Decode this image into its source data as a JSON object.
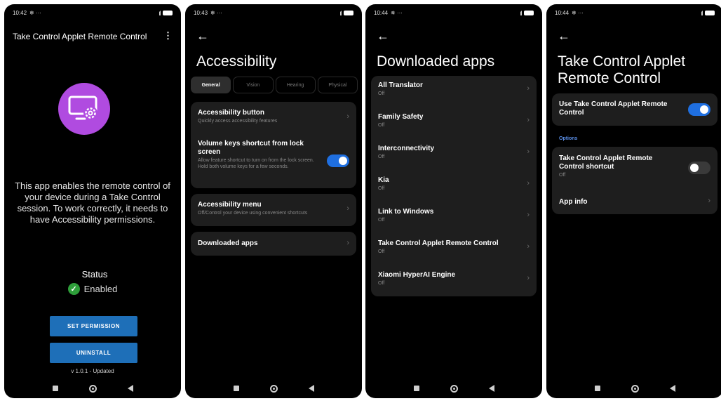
{
  "screen1": {
    "status_time": "10:42",
    "status_icons": "❄ ···",
    "battery": "96",
    "title": "Take Control Applet Remote Control",
    "menu_icon": "kebab-menu-icon",
    "description": "This app enables the remote control of your device during a Take Control session. To work correctly, it needs to have Accessibility permissions.",
    "status_label": "Status",
    "status_value": "Enabled",
    "set_permission": "SET PERMISSION",
    "uninstall": "UNINSTALL",
    "version": "v 1.0.1 - Updated",
    "accent": "#b04be0",
    "button_color": "#1e6fb8"
  },
  "screen2": {
    "status_time": "10:43",
    "status_icons": "❄ ···",
    "battery": "96",
    "title": "Accessibility",
    "tabs": [
      "General",
      "Vision",
      "Hearing",
      "Physical"
    ],
    "accessibility_button": {
      "title": "Accessibility button",
      "sub": "Quickly access accessibility features"
    },
    "volume_keys": {
      "title": "Volume keys shortcut from lock screen",
      "sub": "Allow feature shortcut to turn on from the lock screen. Hold both volume keys for a few seconds."
    },
    "accessibility_menu": {
      "title": "Accessibility menu",
      "sub": "Off/Control your device using convenient shortcuts"
    },
    "downloaded_apps": "Downloaded apps"
  },
  "screen3": {
    "status_time": "10:44",
    "status_icons": "✵ ···",
    "battery": "96",
    "title": "Downloaded apps",
    "apps": [
      {
        "name": "All Translator",
        "state": "Off"
      },
      {
        "name": "Family Safety",
        "state": "Off"
      },
      {
        "name": "Interconnectivity",
        "state": "Off"
      },
      {
        "name": "Kia",
        "state": "Off"
      },
      {
        "name": "Link to Windows",
        "state": "Off"
      },
      {
        "name": "Take Control Applet Remote Control",
        "state": "Off"
      },
      {
        "name": "Xiaomi HyperAI Engine",
        "state": "Off"
      }
    ]
  },
  "screen4": {
    "status_time": "10:44",
    "status_icons": "❄ ···",
    "battery": "96",
    "title": "Take Control Applet Remote Control",
    "use_app": "Use Take Control Applet Remote Control",
    "options_label": "Options",
    "shortcut": {
      "title": "Take Control Applet Remote Control shortcut",
      "state": "Off"
    },
    "app_info": "App info"
  }
}
